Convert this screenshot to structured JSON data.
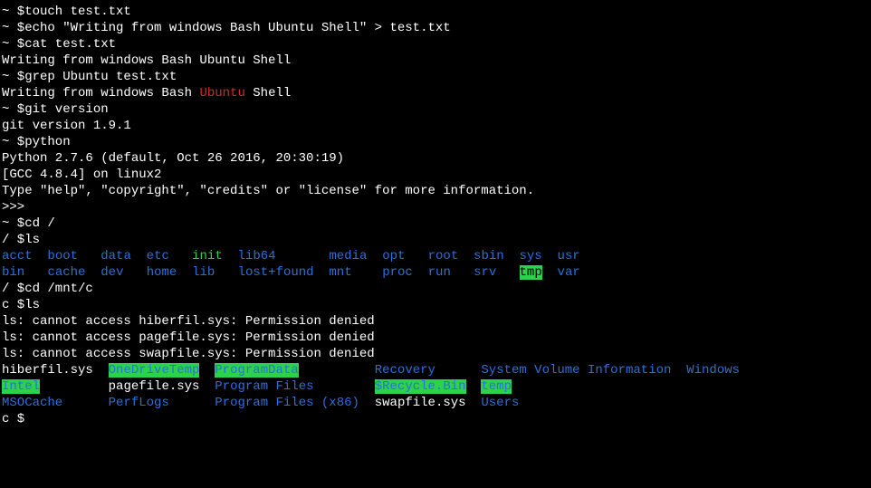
{
  "colors": {
    "bg": "#000000",
    "fg": "#ffffff",
    "dir": "#2d6fde",
    "exe": "#2bd24c",
    "hl_bg": "#2bd24c",
    "red": "#d22b2b"
  },
  "lines": {
    "l0": "~ $touch test.txt",
    "l1": "~ $echo \"Writing from windows Bash Ubuntu Shell\" > test.txt",
    "l2": "~ $cat test.txt",
    "l3": "Writing from windows Bash Ubuntu Shell",
    "l4": "~ $grep Ubuntu test.txt",
    "l5a": "Writing from windows Bash ",
    "l5b": "Ubuntu",
    "l5c": " Shell",
    "l6": "~ $git version",
    "l7": "git version 1.9.1",
    "l8": "~ $python",
    "l9": "Python 2.7.6 (default, Oct 26 2016, 20:30:19)",
    "l10": "[GCC 4.8.4] on linux2",
    "l11": "Type \"help\", \"copyright\", \"credits\" or \"license\" for more information.",
    "l12": ">>>",
    "l13": "~ $cd /",
    "l14": "/ $ls",
    "root_row1": {
      "acct": "acct",
      "boot": "boot",
      "data": "data",
      "etc": "etc",
      "init": "init",
      "lib64": "lib64",
      "media": "media",
      "opt": "opt",
      "root": "root",
      "sbin": "sbin",
      "sys": "sys",
      "usr": "usr"
    },
    "root_row2": {
      "bin": "bin",
      "cache": "cache",
      "dev": "dev",
      "home": "home",
      "lib": "lib",
      "lostfound": "lost+found",
      "mnt": "mnt",
      "proc": "proc",
      "run": "run",
      "srv": "srv",
      "tmp": "tmp",
      "var": "var"
    },
    "l17": "/ $cd /mnt/c",
    "l18": "c $ls",
    "l19": "ls: cannot access hiberfil.sys: Permission denied",
    "l20": "ls: cannot access pagefile.sys: Permission denied",
    "l21": "ls: cannot access swapfile.sys: Permission denied",
    "c_row1": {
      "hiberfil": "hiberfil.sys",
      "onedrive": "OneDriveTemp",
      "programdata": "ProgramData",
      "recovery": "Recovery",
      "sysvol": "System Volume Information",
      "windows": "Windows"
    },
    "c_row2": {
      "intel": "Intel",
      "pagefile": "pagefile.sys",
      "programfiles": "Program Files",
      "recycle": "$Recycle.Bin",
      "temp": "temp"
    },
    "c_row3": {
      "msocache": "MSOCache",
      "perflogs": "PerfLogs",
      "pf86": "Program Files (x86)",
      "swapfile": "swapfile.sys",
      "users": "Users"
    },
    "l25": "c $"
  }
}
